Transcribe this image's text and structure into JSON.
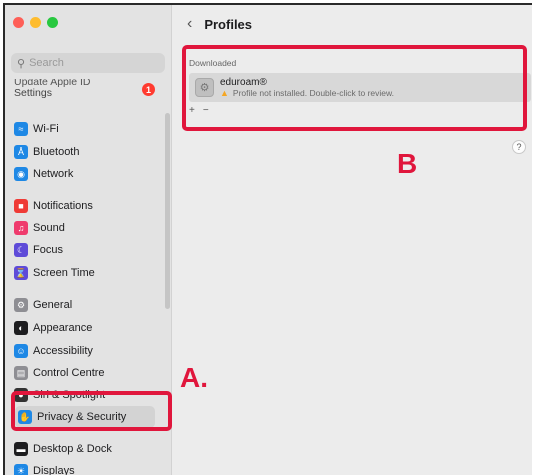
{
  "sidebar": {
    "search_placeholder": "Search",
    "apple_id_line1": "Update Apple ID",
    "apple_id_line2": "Settings",
    "apple_id_badge": "1",
    "items": [
      {
        "label": "Wi-Fi",
        "icon": "wifi-icon",
        "color": "#1e88e5"
      },
      {
        "label": "Bluetooth",
        "icon": "bluetooth-icon",
        "color": "#1e88e5"
      },
      {
        "label": "Network",
        "icon": "globe-icon",
        "color": "#1e88e5"
      },
      {
        "label": "Notifications",
        "icon": "bell-icon",
        "color": "#ef3b36"
      },
      {
        "label": "Sound",
        "icon": "speaker-icon",
        "color": "#ef3b6d"
      },
      {
        "label": "Focus",
        "icon": "moon-icon",
        "color": "#5e4bd8"
      },
      {
        "label": "Screen Time",
        "icon": "hourglass-icon",
        "color": "#5e4bd8"
      },
      {
        "label": "General",
        "icon": "gear-icon",
        "color": "#8e8e93"
      },
      {
        "label": "Appearance",
        "icon": "appearance-icon",
        "color": "#1d1d1f"
      },
      {
        "label": "Accessibility",
        "icon": "accessibility-icon",
        "color": "#1e88e5"
      },
      {
        "label": "Control Centre",
        "icon": "control-centre-icon",
        "color": "#8e8e93"
      },
      {
        "label": "Siri & Spotlight",
        "icon": "siri-icon",
        "color": "#333333"
      },
      {
        "label": "Privacy & Security",
        "icon": "hand-icon",
        "color": "#1e88e5"
      },
      {
        "label": "Desktop & Dock",
        "icon": "dock-icon",
        "color": "#1d1d1f"
      },
      {
        "label": "Displays",
        "icon": "sun-icon",
        "color": "#1e88e5"
      }
    ]
  },
  "main": {
    "title": "Profiles",
    "section_label": "Downloaded",
    "profile": {
      "name": "eduroam®",
      "status": "Profile not installed. Double-click to review."
    },
    "add_label": "+",
    "remove_label": "−",
    "help_label": "?"
  },
  "annotations": {
    "label_a": "A.",
    "label_b": "B",
    "color": "#e0163c"
  }
}
